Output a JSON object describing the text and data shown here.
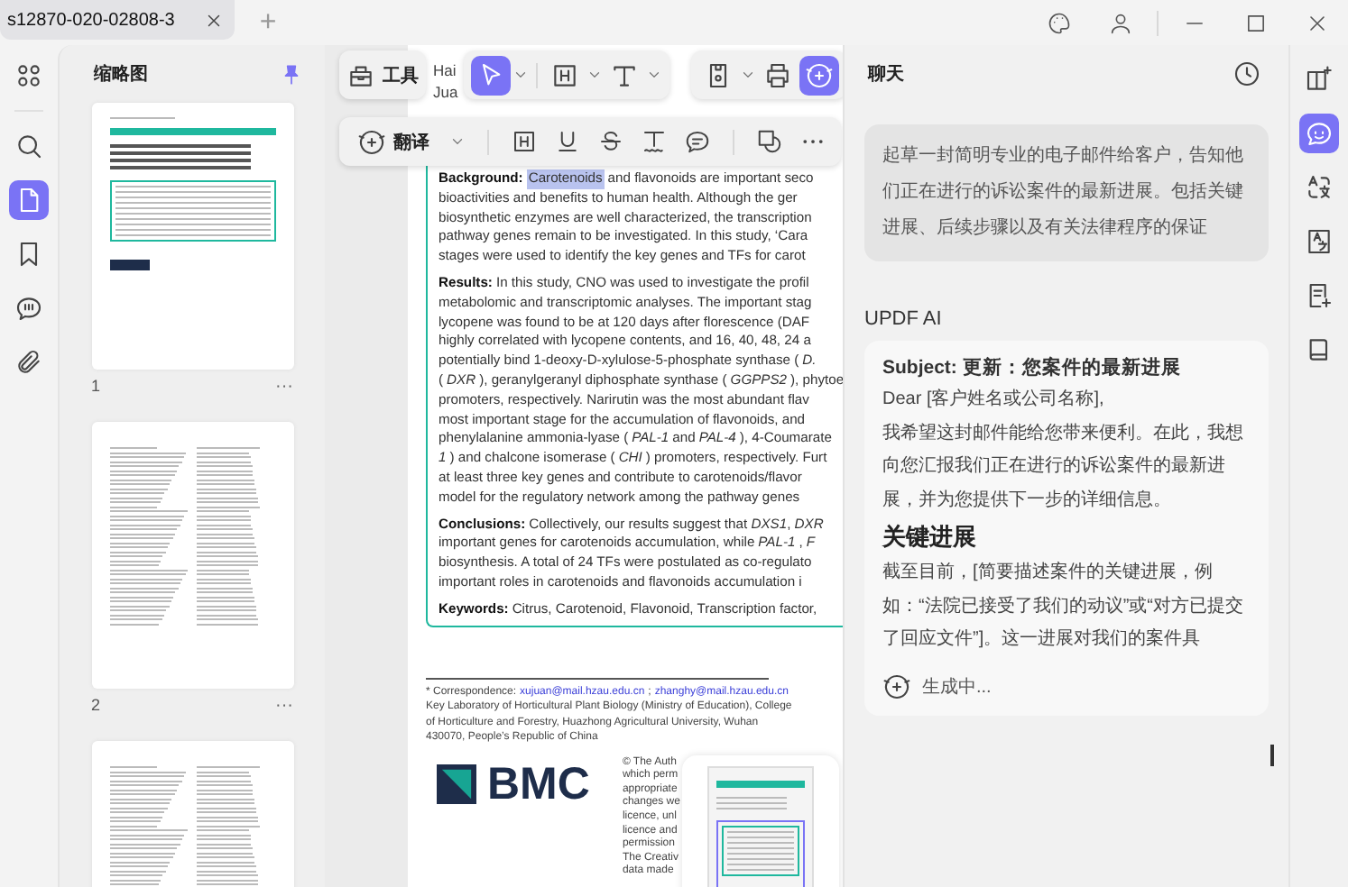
{
  "tabs": [
    {
      "label": "s12870-020-02808-3",
      "selected": true,
      "closable": true
    }
  ],
  "new_tab": "+",
  "window_controls": [
    {
      "kind": "palette"
    },
    {
      "kind": "user"
    },
    {
      "kind": "minimize"
    },
    {
      "kind": "maximize"
    },
    {
      "kind": "close"
    }
  ],
  "left_rail": [
    {
      "kind": "grid",
      "selected": false
    },
    {
      "kind": "search",
      "selected": false
    },
    {
      "kind": "page",
      "selected": true
    },
    {
      "kind": "bookmark",
      "selected": false
    },
    {
      "kind": "comment",
      "selected": false
    },
    {
      "kind": "attachment",
      "selected": false
    }
  ],
  "thumbnails": {
    "title": "缩略图",
    "pages": [
      {
        "kind": "cover",
        "number": "1",
        "more": "···"
      },
      {
        "kind": "text",
        "number": "2",
        "more": "···"
      },
      {
        "kind": "text"
      }
    ]
  },
  "toolbar": {
    "tools_label": "工具",
    "groups": [
      [
        {
          "kind": "cursor",
          "selected": true,
          "dropdown": true
        },
        {
          "kind": "textbox",
          "selected": false,
          "dropdown": true
        },
        {
          "kind": "text",
          "selected": false,
          "dropdown": true
        }
      ],
      [
        {
          "kind": "save",
          "selected": false,
          "dropdown": true
        },
        {
          "kind": "print",
          "selected": false,
          "dropdown": false
        },
        {
          "kind": "ai",
          "selected": true,
          "dropdown": false
        }
      ]
    ]
  },
  "annotation_bar": {
    "translate_label": "翻译",
    "tools": [
      {
        "kind": "highlight"
      },
      {
        "kind": "underline"
      },
      {
        "kind": "strikethrough"
      },
      {
        "kind": "squiggly"
      },
      {
        "kind": "note"
      },
      {
        "kind": "shapes"
      },
      {
        "kind": "more"
      }
    ]
  },
  "document": {
    "author_fragments": [
      "Hai",
      "Jua"
    ],
    "abstract": [
      {
        "heading": "Background:",
        "highlight": "Carotenoids",
        "lines": [
          "and flavonoids are important seco",
          "bioactivities and benefits to human health. Although the ger",
          "biosynthetic enzymes are well characterized, the transcription",
          "pathway genes remain to be investigated. In this study, ‘Cara",
          "stages were used to identify the key genes and TFs for carot"
        ]
      },
      {
        "heading": "Results:",
        "lines": [
          "In this study, CNO was used to investigate the profil",
          "metabolomic and transcriptomic analyses. The important stag",
          "lycopene was found to be at 120 days after florescence (DAF",
          "highly correlated with lycopene contents, and 16, 40, 48, 24 a",
          "potentially bind 1-deoxy-D-xylulose-5-phosphate synthase (*D.*",
          "(*DXR*), geranylgeranyl diphosphate synthase (*GGPPS2*), phytoe",
          "promoters, respectively. Narirutin was the most abundant flav",
          "most important stage for the accumulation of flavonoids, and",
          "phenylalanine ammonia-lyase (*PAL-1* and *PAL-4*), 4-Coumarate",
          "*1*) and chalcone isomerase (*CHI*) promoters, respectively. Furt",
          "at least three key genes and contribute to carotenoids/flavor",
          "model for the regulatory network among the pathway genes"
        ]
      },
      {
        "heading": "Conclusions:",
        "lines": [
          "Collectively, our results suggest that *DXS1*, *DXR*",
          "important genes for carotenoids accumulation, while *PAL-1*, *F*",
          "biosynthesis. A total of 24 TFs were postulated as co-regulato",
          "important roles in carotenoids and flavonoids accumulation i"
        ]
      },
      {
        "heading": "Keywords:",
        "lines": [
          "Citrus, Carotenoid, Flavonoid, Transcription factor,"
        ]
      }
    ],
    "correspondence": {
      "label": "* Correspondence:",
      "emails": [
        "xujuan@mail.hzau.edu.cn",
        "zhanghy@mail.hzau.edu.cn"
      ],
      "separator": ";"
    },
    "affiliation": [
      "Key Laboratory of Horticultural Plant Biology (Ministry of Education), College",
      "of Horticulture and Forestry, Huazhong Agricultural University, Wuhan",
      "430070, People’s Republic of China"
    ],
    "logo": "BMC",
    "license_lines": [
      "© The Auth",
      "which perm",
      "appropriate",
      "changes we",
      "licence, unl",
      "licence and",
      "permission",
      "The Creativ",
      "data made"
    ]
  },
  "chat": {
    "title": "聊天",
    "user_message": "起草一封简明专业的电子邮件给客户，告知他们正在进行的诉讼案件的最新进展。包括关键进展、后续步骤以及有关法律程序的保证",
    "assistant_name": "UPDF AI",
    "reply": [
      {
        "kind": "subject",
        "text": "Subject: 更新：您案件的最新进展"
      },
      {
        "kind": "paragraph",
        "text": "Dear [客户姓名或公司名称],"
      },
      {
        "kind": "paragraph",
        "text": "我希望这封邮件能给您带来便利。在此，我想向您汇报我们正在进行的诉讼案件的最新进展，并为您提供下一步的详细信息。"
      },
      {
        "kind": "heading",
        "text": "关键进展"
      },
      {
        "kind": "paragraph",
        "text": "截至目前，[简要描述案件的关键进展，例如：“法院已接受了我们的动议”或“对方已提交了回应文件”]。这一进展对我们的案件具"
      }
    ],
    "status": "生成中..."
  },
  "right_rail": [
    {
      "kind": "book-sparkle",
      "selected": false
    },
    {
      "kind": "chat-ai",
      "selected": true
    },
    {
      "kind": "translate",
      "selected": false
    },
    {
      "kind": "translate-box",
      "selected": false
    },
    {
      "kind": "note-sparkle",
      "selected": false
    },
    {
      "kind": "book",
      "selected": false
    }
  ]
}
